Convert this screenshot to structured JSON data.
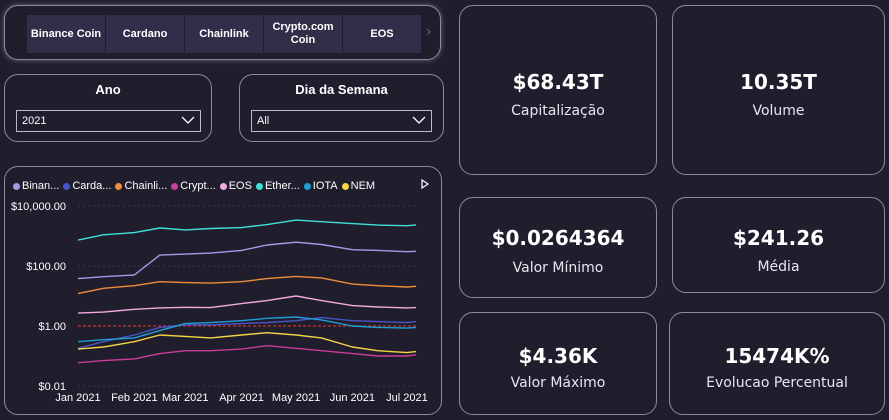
{
  "coins": {
    "tiles": [
      {
        "label": "Binance Coin"
      },
      {
        "label": "Cardano"
      },
      {
        "label": "Chainlink"
      },
      {
        "label": "Crypto.com Coin"
      },
      {
        "label": "EOS"
      }
    ],
    "scroll_icon": "chevron-right-icon"
  },
  "filters": {
    "ano": {
      "title": "Ano",
      "value": "2021"
    },
    "dia": {
      "title": "Dia da Semana",
      "value": "All"
    }
  },
  "kpis": [
    {
      "value": "$68.43T",
      "label": "Capitalização"
    },
    {
      "value": "10.35T",
      "label": "Volume"
    },
    {
      "value": "$0.0264364",
      "label": "Valor Mínimo"
    },
    {
      "value": "$241.26",
      "label": "Média"
    },
    {
      "value": "$4.36K",
      "label": "Valor Máximo"
    },
    {
      "value": "15474K%",
      "label": "Evolucao Percentual"
    }
  ],
  "legend": {
    "items": [
      {
        "label": "Binan...",
        "color": "#a79be6"
      },
      {
        "label": "Carda...",
        "color": "#4a55c9"
      },
      {
        "label": "Chainli...",
        "color": "#f08c3c"
      },
      {
        "label": "Crypt...",
        "color": "#c83e98"
      },
      {
        "label": "EOS",
        "color": "#f4a9dd"
      },
      {
        "label": "Ether...",
        "color": "#40e0d8"
      },
      {
        "label": "IOTA",
        "color": "#1f9fd8"
      },
      {
        "label": "NEM",
        "color": "#f5d548"
      }
    ],
    "more_icon": "play-right-icon"
  },
  "chart_data": {
    "type": "line",
    "yscale": "log",
    "ylim": [
      0.01,
      10000
    ],
    "yticks": [
      "$10,000.00",
      "$100.00",
      "$1.00",
      "$0.01"
    ],
    "xticks": [
      "Jan 2021",
      "Feb 2021",
      "Mar 2021",
      "Apr 2021",
      "May 2021",
      "Jun 2021",
      "Jul 2021"
    ],
    "reference_line": {
      "value": 1,
      "color": "#c0392b"
    },
    "x": [
      "2021-01-01",
      "2021-01-15",
      "2021-02-01",
      "2021-02-15",
      "2021-03-01",
      "2021-03-15",
      "2021-04-01",
      "2021-04-15",
      "2021-05-01",
      "2021-05-15",
      "2021-06-01",
      "2021-06-15",
      "2021-07-01",
      "2021-07-06"
    ],
    "series": [
      {
        "name": "Binance Coin",
        "color": "#a79be6",
        "values": [
          38,
          44,
          50,
          230,
          250,
          270,
          330,
          500,
          620,
          520,
          350,
          330,
          300,
          310
        ]
      },
      {
        "name": "Cardano",
        "color": "#4a55c9",
        "values": [
          0.18,
          0.3,
          0.5,
          0.9,
          1.1,
          1.1,
          1.2,
          1.3,
          1.5,
          1.9,
          1.5,
          1.4,
          1.3,
          1.4
        ]
      },
      {
        "name": "Chainlink",
        "color": "#f08c3c",
        "values": [
          12,
          18,
          22,
          30,
          28,
          27,
          30,
          38,
          45,
          40,
          25,
          22,
          20,
          21
        ]
      },
      {
        "name": "Crypto.com Coin",
        "color": "#c83e98",
        "values": [
          0.06,
          0.07,
          0.08,
          0.12,
          0.15,
          0.15,
          0.17,
          0.22,
          0.18,
          0.15,
          0.12,
          0.1,
          0.1,
          0.11
        ]
      },
      {
        "name": "EOS",
        "color": "#f4a9dd",
        "values": [
          2.7,
          2.9,
          3.6,
          4.0,
          4.2,
          4.1,
          5.6,
          7.0,
          10.0,
          7.0,
          4.8,
          4.3,
          4.0,
          4.1
        ]
      },
      {
        "name": "Ethereum",
        "color": "#40e0d8",
        "values": [
          730,
          1100,
          1300,
          1850,
          1600,
          1780,
          1900,
          2400,
          3400,
          3000,
          2600,
          2300,
          2200,
          2350
        ]
      },
      {
        "name": "IOTA",
        "color": "#1f9fd8",
        "values": [
          0.3,
          0.35,
          0.4,
          0.7,
          1.2,
          1.3,
          1.5,
          1.8,
          2.0,
          1.6,
          1.0,
          0.9,
          0.85,
          0.9
        ]
      },
      {
        "name": "NEM",
        "color": "#f5d548",
        "values": [
          0.17,
          0.2,
          0.3,
          0.5,
          0.45,
          0.4,
          0.5,
          0.6,
          0.5,
          0.4,
          0.2,
          0.15,
          0.13,
          0.14
        ]
      }
    ]
  }
}
